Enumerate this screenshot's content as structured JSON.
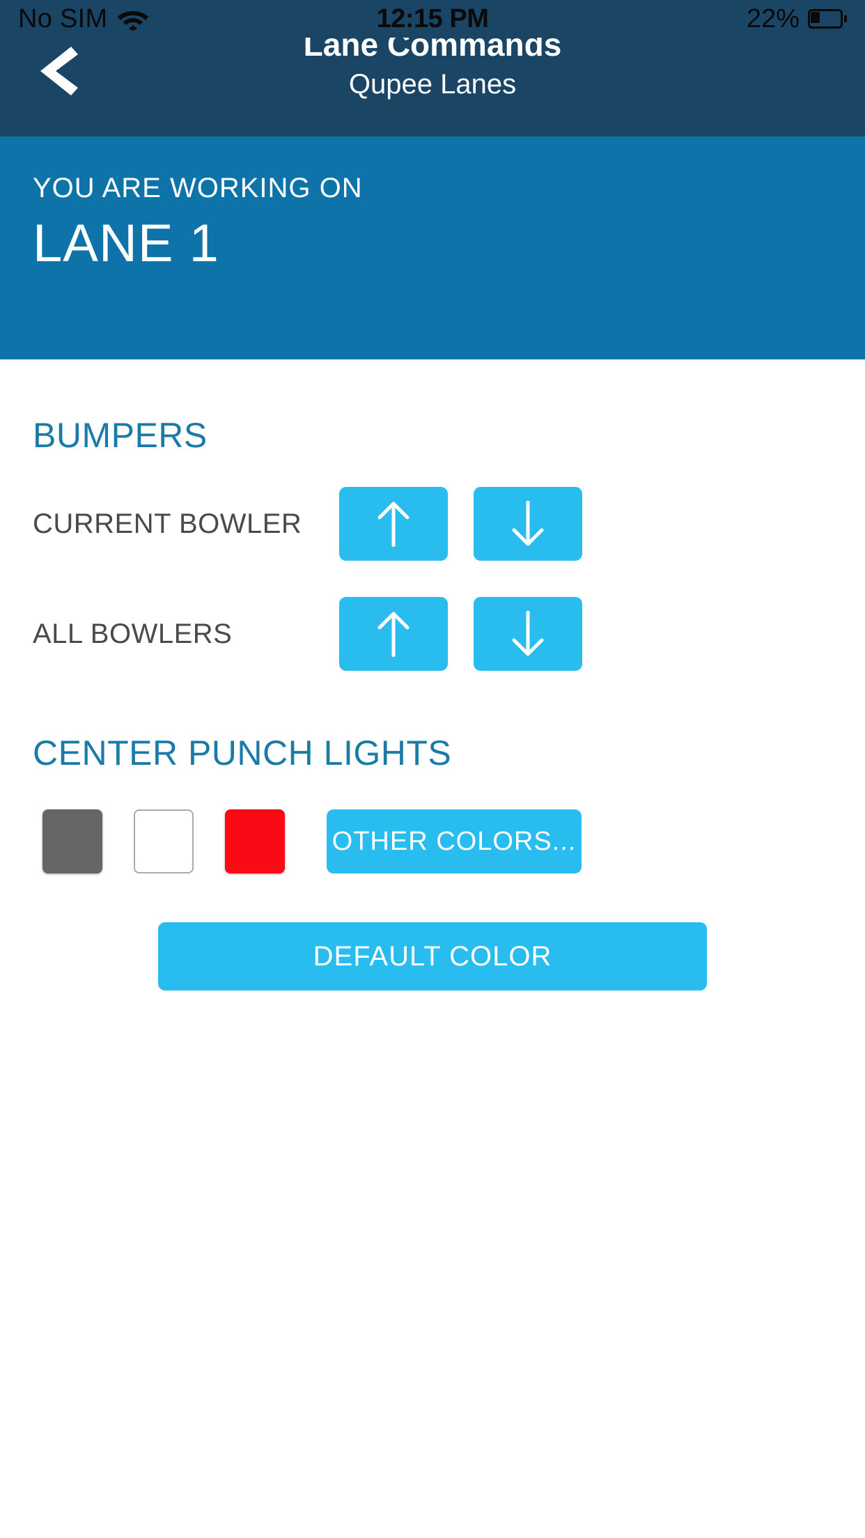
{
  "status_bar": {
    "carrier": "No SIM",
    "wifi_icon": "wifi-icon",
    "time": "12:15 PM",
    "battery_percent": "22%",
    "battery_icon": "battery-icon"
  },
  "nav_header": {
    "back_icon": "chevron-left-icon",
    "title": "Lane Commands",
    "subtitle": "Qupee Lanes",
    "background_color": "#1a4565"
  },
  "lane_banner": {
    "eyebrow": "YOU ARE WORKING ON",
    "lane": "LANE 1",
    "background_color": "#0d73a8"
  },
  "bumpers": {
    "title": "BUMPERS",
    "rows": [
      {
        "label": "CURRENT BOWLER",
        "up_icon": "arrow-up-icon",
        "down_icon": "arrow-down-icon"
      },
      {
        "label": "ALL BOWLERS",
        "up_icon": "arrow-up-icon",
        "down_icon": "arrow-down-icon"
      }
    ]
  },
  "center_punch_lights": {
    "title": "CENTER PUNCH LIGHTS",
    "swatches": [
      {
        "name": "gray",
        "color": "#666666"
      },
      {
        "name": "white",
        "color": "#ffffff"
      },
      {
        "name": "red",
        "color": "#fa0a14"
      }
    ],
    "other_colors_label": "OTHER COLORS...",
    "default_color_label": "DEFAULT COLOR"
  },
  "theme": {
    "accent_blue": "#29bdef",
    "header_blue": "#1a4565",
    "banner_blue": "#0d73a8",
    "section_title_blue": "#1a7aa8"
  }
}
